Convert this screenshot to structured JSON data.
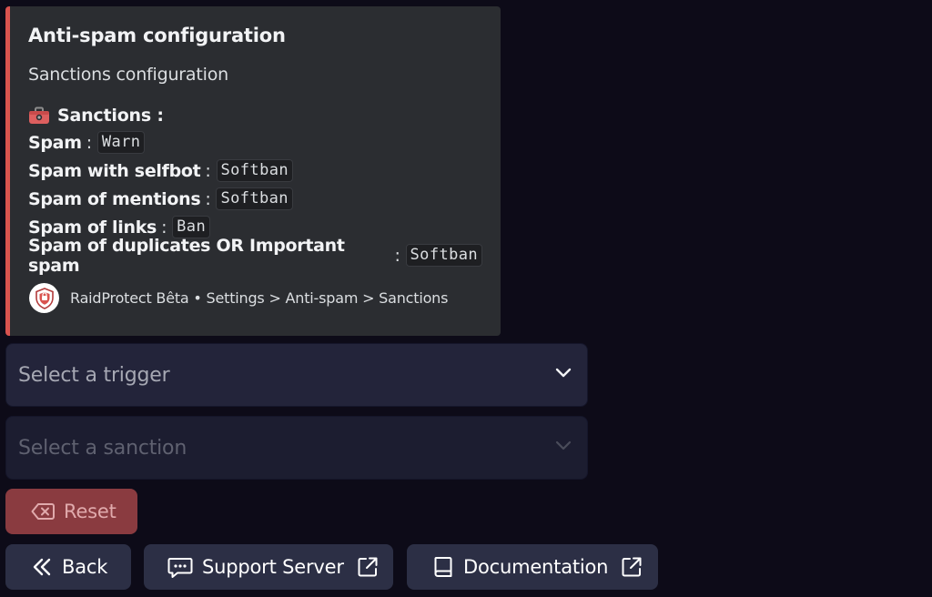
{
  "embed": {
    "accent_color": "#d9534f",
    "title": "Anti-spam configuration",
    "description": "Sanctions configuration",
    "sanctions_heading": "Sanctions :",
    "sanctions_icon": "toolbox-icon",
    "fields": [
      {
        "name": "Spam",
        "value": "Warn"
      },
      {
        "name": "Spam with selfbot",
        "value": "Softban"
      },
      {
        "name": "Spam of mentions",
        "value": "Softban"
      },
      {
        "name": "Spam of links",
        "value": "Ban"
      },
      {
        "name": "Spam of duplicates OR Important spam",
        "value": "Softban"
      }
    ],
    "separator": ":",
    "footer": {
      "avatar_icon": "raidprotect-shield-icon",
      "text": "RaidProtect Bêta • Settings > Anti-spam > Sanctions"
    }
  },
  "selects": {
    "trigger_placeholder": "Select a trigger",
    "sanction_placeholder": "Select a sanction"
  },
  "buttons": {
    "reset": "Reset",
    "back": "Back",
    "support": "Support Server",
    "docs": "Documentation"
  },
  "colors": {
    "background": "#0d0b18",
    "embed_bg": "#2b2d31",
    "danger_button": "#8a3b40",
    "secondary_button": "#2c2f45"
  }
}
